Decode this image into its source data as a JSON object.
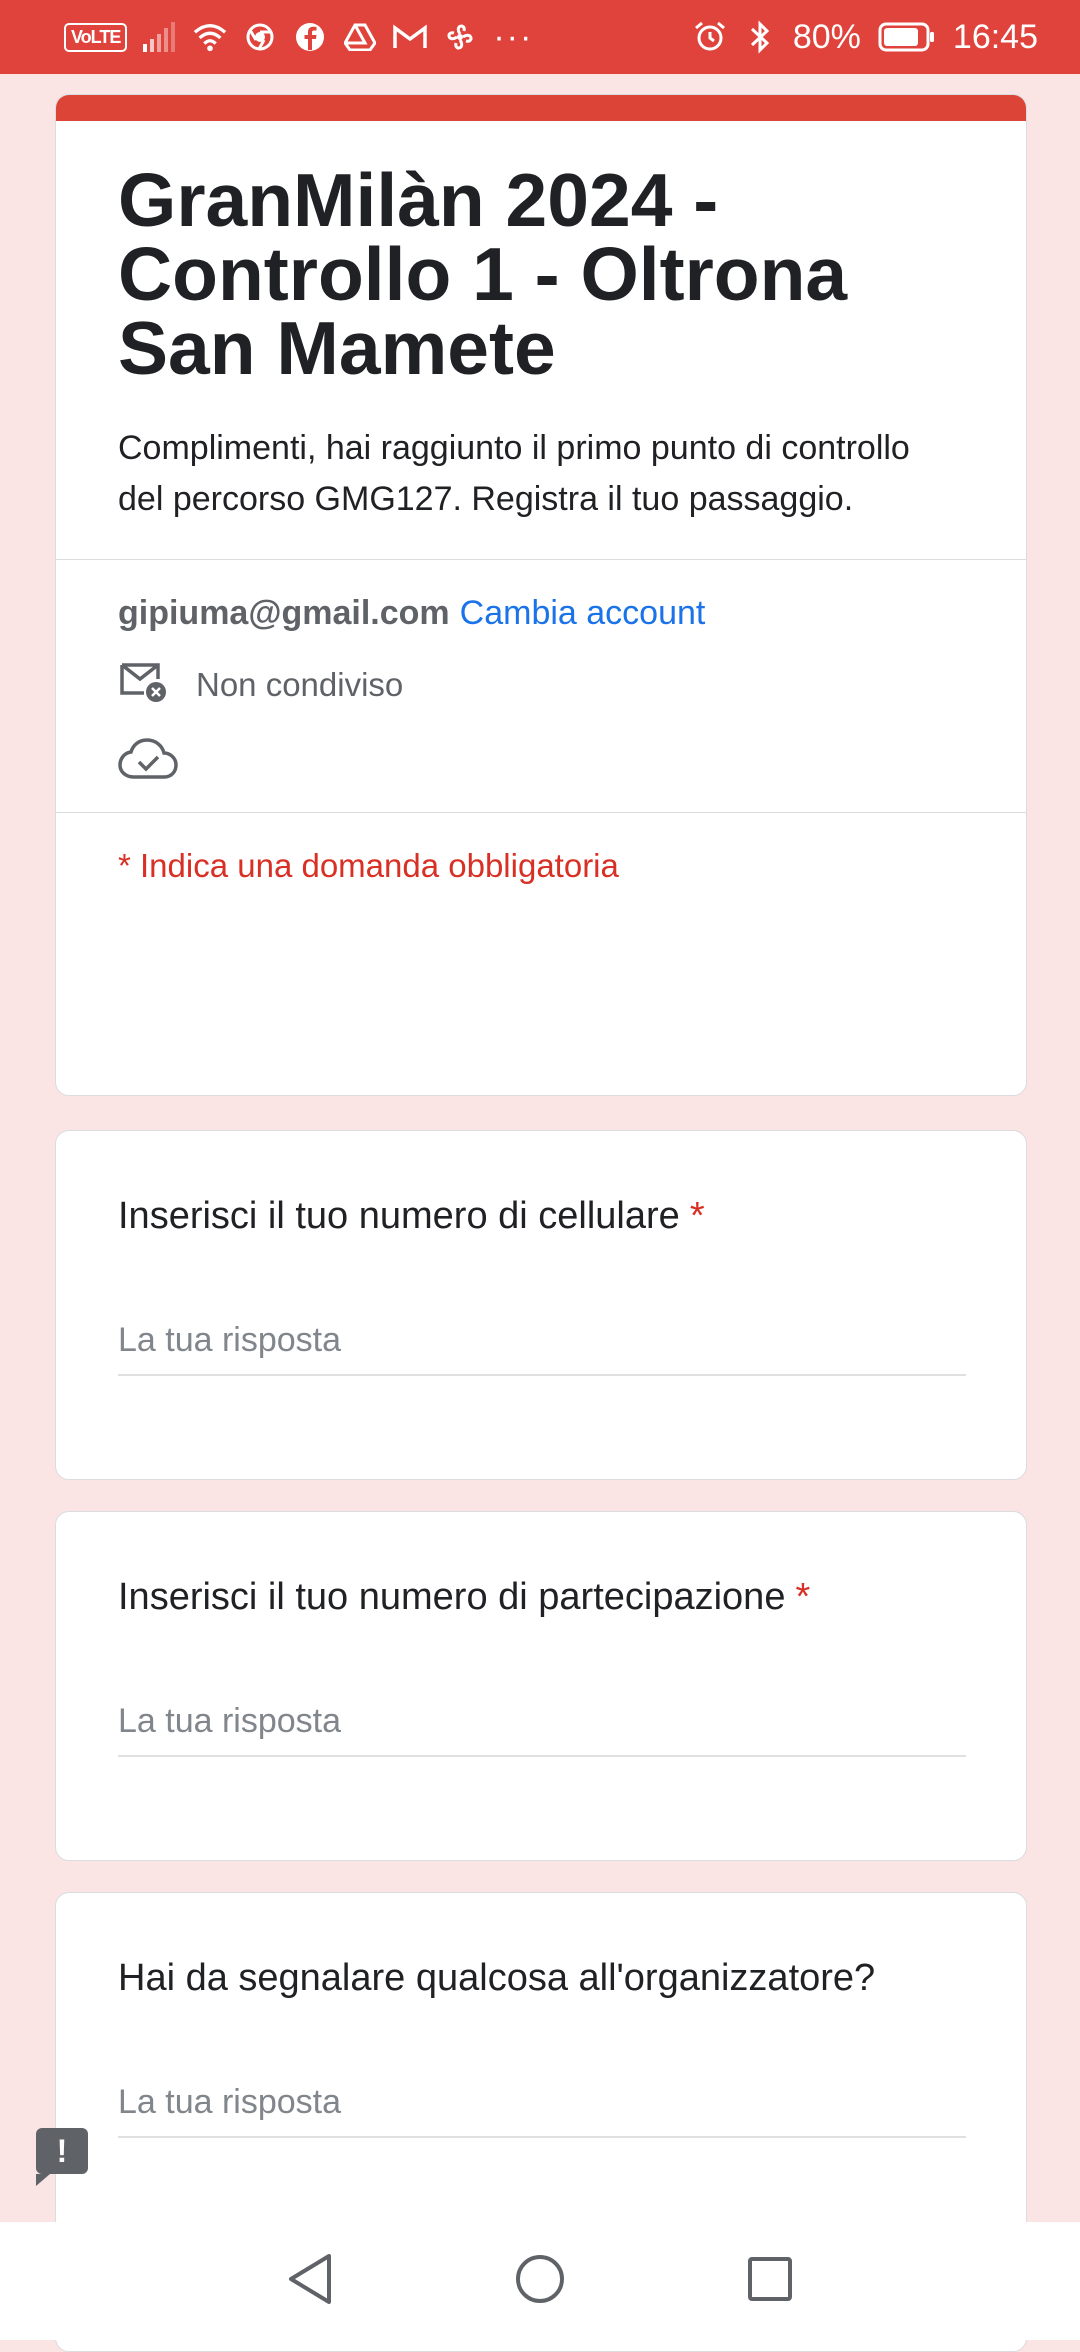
{
  "status_bar": {
    "left": {
      "volte": "VoLTE",
      "more": "···"
    },
    "right": {
      "battery_percent": "80%",
      "time": "16:45"
    },
    "icons": [
      "signal-icon",
      "wifi-icon",
      "chrome-icon",
      "facebook-icon",
      "drive-icon",
      "gmail-icon",
      "fan-icon",
      "alarm-icon",
      "bluetooth-icon",
      "battery-icon"
    ]
  },
  "form": {
    "accent_color": "#db4437",
    "title": "GranMilàn 2024 - Controllo 1 - Oltrona San Mamete",
    "description": "Complimenti, hai raggiunto il primo punto di controllo del percorso GMG127. Registra il tuo passaggio.",
    "account": {
      "email": "gipiuma@gmail.com",
      "change_label": "Cambia account",
      "sharing_status": "Non condiviso"
    },
    "required_note": "* Indica una domanda obbligatoria",
    "questions": [
      {
        "label": "Inserisci il tuo numero di cellulare",
        "required_mark": "*",
        "placeholder": "La tua risposta"
      },
      {
        "label": "Inserisci il tuo numero di partecipazione",
        "required_mark": "*",
        "placeholder": "La tua risposta"
      },
      {
        "label": "Hai da segnalare qualcosa all'organizzatore?",
        "placeholder": "La tua risposta"
      }
    ]
  },
  "feedback": {
    "symbol": "!"
  }
}
